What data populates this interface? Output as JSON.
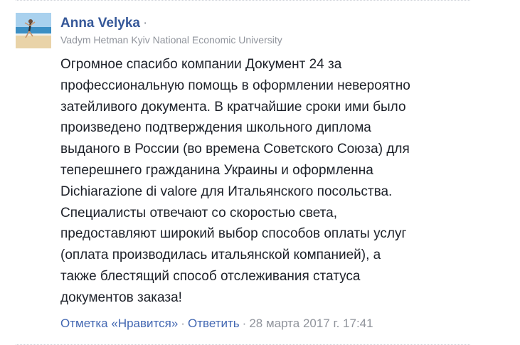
{
  "comment": {
    "author": "Anna Velyka",
    "author_separator": "·",
    "affiliation": "Vadym Hetman Kyiv National Economic University",
    "avatar_icon": "profile-photo-beach",
    "body_lines": [
      "Огромное спасибо компании Документ 24 за",
      "профессиональную помощь в оформлении невероятно",
      "затейливого документа. В кратчайшие сроки ими было",
      "произведено подтверждения школьного диплома",
      "выданого в России (во времена Советского Союза) для",
      "теперешнего гражданина Украины и оформленна",
      "Dichiarazione di valore для Итальянского посольства.",
      "Специалисты отвечают со скоростью света,",
      "предоставляют широкий выбор способов оплаты услуг",
      "(оплата производилась итальянской компанией), а",
      "также блестящий способ отслеживания статуса",
      "документов заказа!"
    ],
    "actions": {
      "like_label": "Отметка «Нравится»",
      "separator": "·",
      "reply_label": "Ответить",
      "timestamp": "28 марта 2017 г. 17:41"
    }
  },
  "colors": {
    "author_link": "#365899",
    "action_link": "#4267b2",
    "meta_text": "#90949c",
    "body_text": "#1d2129"
  }
}
